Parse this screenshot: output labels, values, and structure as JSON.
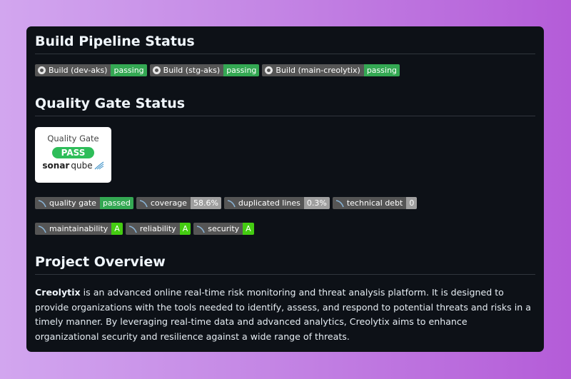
{
  "build": {
    "heading": "Build Pipeline Status",
    "badges": [
      {
        "label": "Build (dev-aks)",
        "status": "passing",
        "icon": "github-icon"
      },
      {
        "label": "Build (stg-aks)",
        "status": "passing",
        "icon": "github-icon"
      },
      {
        "label": "Build (main-creolytix)",
        "status": "passing",
        "icon": "github-icon"
      }
    ]
  },
  "quality": {
    "heading": "Quality Gate Status",
    "gate_box": {
      "title": "Quality Gate",
      "status": "PASS",
      "logo_bold": "sonar",
      "logo_thin": "qube"
    },
    "metrics_row1": [
      {
        "label": "quality gate",
        "value": "passed"
      },
      {
        "label": "coverage",
        "value": "58.6%"
      },
      {
        "label": "duplicated lines",
        "value": "0.3%"
      },
      {
        "label": "technical debt",
        "value": "0"
      }
    ],
    "metrics_row2": [
      {
        "label": "maintainability",
        "value": "A"
      },
      {
        "label": "reliability",
        "value": "A"
      },
      {
        "label": "security",
        "value": "A"
      }
    ]
  },
  "overview": {
    "heading": "Project Overview",
    "name": "Creolytix",
    "text": " is an advanced online real-time risk monitoring and threat analysis platform. It is designed to provide organizations with the tools needed to identify, assess, and respond to potential threats and risks in a timely manner. By leveraging real-time data and advanced analytics, Creolytix aims to enhance organizational security and resilience against a wide range of threats."
  },
  "colors": {
    "passing": "#34a853",
    "grade_a": "#44cc11",
    "neutral_value": "#9f9f9f",
    "card_bg": "#0d1117"
  }
}
